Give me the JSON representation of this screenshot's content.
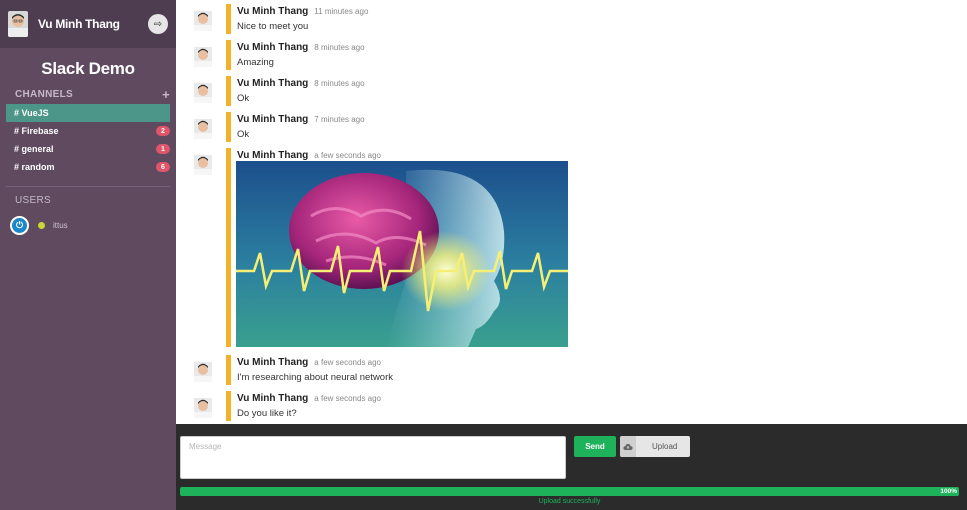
{
  "sidebar": {
    "username": "Vu Minh Thang",
    "workspace": "Slack Demo",
    "channels_heading": "CHANNELS",
    "add_symbol": "+",
    "channels": [
      {
        "label": "# VueJS",
        "badge": "",
        "active": true
      },
      {
        "label": "# Firebase",
        "badge": "2",
        "active": false
      },
      {
        "label": "# general",
        "badge": "1",
        "active": false
      },
      {
        "label": "# random",
        "badge": "6",
        "active": false
      }
    ],
    "users_heading": "USERS",
    "users": [
      {
        "name": "ittus",
        "status": "online"
      }
    ]
  },
  "messages": [
    {
      "author": "Vu Minh Thang",
      "time": "11 minutes ago",
      "text": "Nice to meet you"
    },
    {
      "author": "Vu Minh Thang",
      "time": "8 minutes ago",
      "text": "Amazing"
    },
    {
      "author": "Vu Minh Thang",
      "time": "8 minutes ago",
      "text": "Ok"
    },
    {
      "author": "Vu Minh Thang",
      "time": "7 minutes ago",
      "text": "Ok"
    },
    {
      "author": "Vu Minh Thang",
      "time": "a few seconds ago",
      "text": ""
    },
    {
      "author": "Vu Minh Thang",
      "time": "a few seconds ago",
      "text": "I'm researching about neural network"
    },
    {
      "author": "Vu Minh Thang",
      "time": "a few seconds ago",
      "text": "Do you like it?"
    }
  ],
  "composer": {
    "placeholder": "Message",
    "send_label": "Send",
    "upload_label": "Upload",
    "progress": 100,
    "progress_label": "100%",
    "status": "Upload successfully"
  },
  "colors": {
    "sidebar": "#5f4a60",
    "active_channel": "#4c9689",
    "badge": "#e0556a",
    "message_bar": "#f2b12b",
    "send": "#1eb35a",
    "composer_bg": "#2b2b2b"
  }
}
